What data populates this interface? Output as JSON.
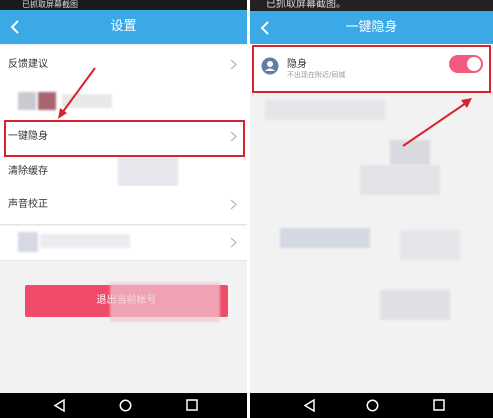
{
  "left_screen": {
    "status_text": "已抓取屏幕截图",
    "title": "设置",
    "rows": [
      {
        "label": "反馈建议"
      },
      {
        "label": "一键隐身"
      },
      {
        "label": "清除缓存"
      },
      {
        "label": "声音校正"
      }
    ],
    "logout_label": "退出当前帐号"
  },
  "right_screen": {
    "status_text": "已抓取屏幕截图。",
    "title": "一键隐身",
    "stealth_label": "隐身",
    "stealth_desc": "不出现在附近/同城",
    "toggle_on": true
  },
  "colors": {
    "titlebar": "#3aa9e6",
    "annotation": "#d7232d",
    "logout": "#f04c6a",
    "toggle": "#f35b7e"
  }
}
